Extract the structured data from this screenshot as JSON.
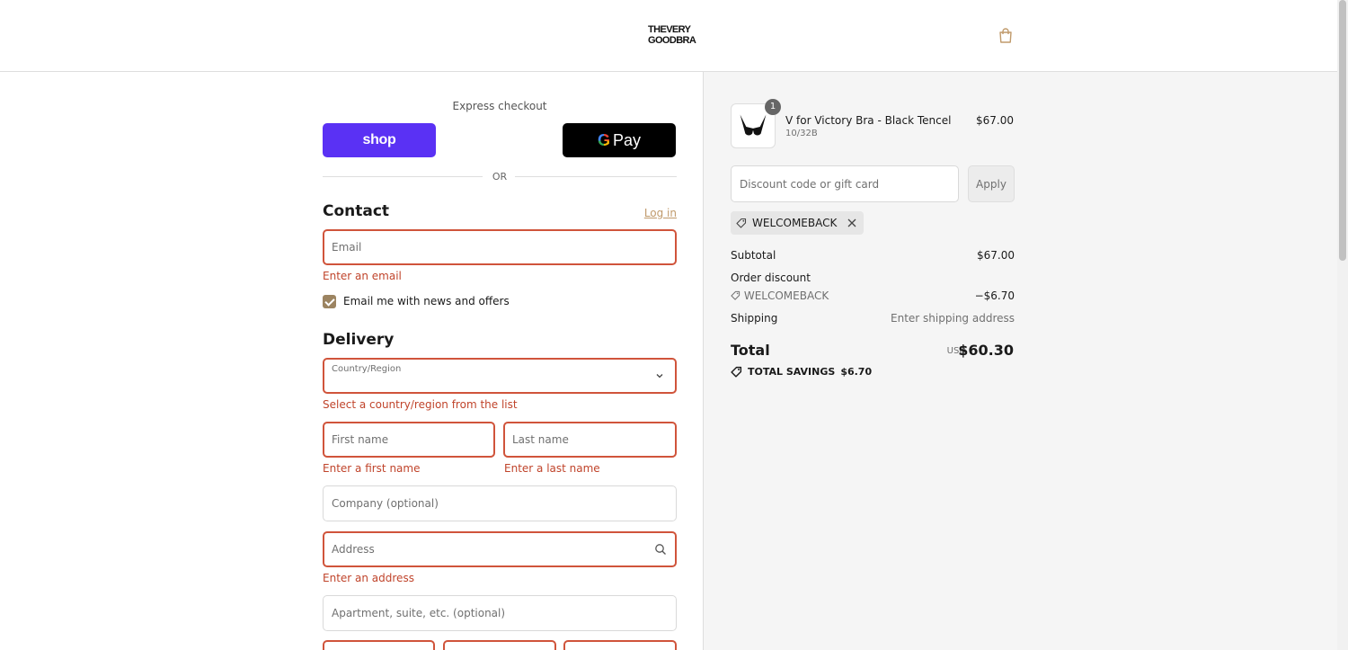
{
  "header": {
    "logo_line1": "THEVERY",
    "logo_line2": "GOODBRA",
    "cart_icon": "shopping-bag-icon"
  },
  "express": {
    "title": "Express checkout",
    "shop_label": "shop",
    "gpay_g": "G",
    "gpay_label": "Pay",
    "or_label": "OR"
  },
  "contact": {
    "title": "Contact",
    "login_label": "Log in",
    "email_placeholder": "Email",
    "email_error": "Enter an email",
    "newsletter_label": "Email me with news and offers",
    "newsletter_checked": true
  },
  "delivery": {
    "title": "Delivery",
    "country_label": "Country/Region",
    "country_error": "Select a country/region from the list",
    "first_name_placeholder": "First name",
    "first_name_error": "Enter a first name",
    "last_name_placeholder": "Last name",
    "last_name_error": "Enter a last name",
    "company_placeholder": "Company (optional)",
    "address_placeholder": "Address",
    "address_error": "Enter an address",
    "apartment_placeholder": "Apartment, suite, etc. (optional)"
  },
  "summary": {
    "product": {
      "name": "V for Victory Bra - Black Tencel",
      "variant": "10/32B",
      "price": "$67.00",
      "quantity": "1"
    },
    "discount_placeholder": "Discount code or gift card",
    "apply_label": "Apply",
    "applied_code": "WELCOMEBACK",
    "subtotal_label": "Subtotal",
    "subtotal_value": "$67.00",
    "order_discount_label": "Order discount",
    "discount_code": "WELCOMEBACK",
    "discount_value": "−$6.70",
    "shipping_label": "Shipping",
    "shipping_value": "Enter shipping address",
    "total_label": "Total",
    "currency": "USD",
    "total_value": "$60.30",
    "savings_label": "TOTAL SAVINGS",
    "savings_value": "$6.70"
  },
  "colors": {
    "accent": "#c09a6b",
    "error": "#d0543b",
    "shop_purple": "#5a31f4",
    "checkbox": "#9c8461"
  }
}
